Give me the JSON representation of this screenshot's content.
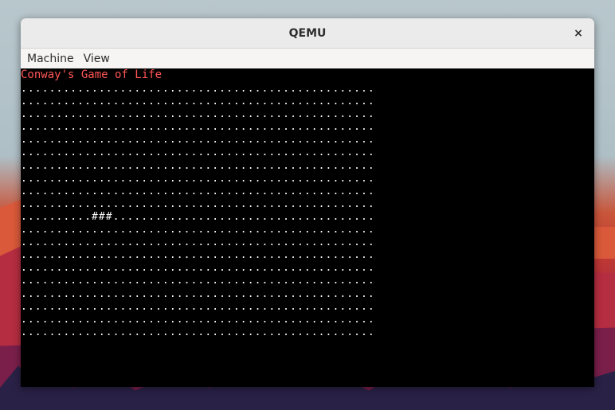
{
  "window": {
    "title": "QEMU",
    "close_icon": "×"
  },
  "menu": {
    "items": [
      "Machine",
      "View"
    ]
  },
  "screen": {
    "title": "Conway's Game of Life",
    "grid_rows": [
      "..................................................",
      "..................................................",
      "..................................................",
      "..................................................",
      "..................................................",
      "..................................................",
      "..................................................",
      "..................................................",
      "..................................................",
      "..................................................",
      "..........###.....................................",
      "..................................................",
      "..................................................",
      "..................................................",
      "..................................................",
      "..................................................",
      "..................................................",
      "..................................................",
      "..................................................",
      ".................................................."
    ]
  },
  "colors": {
    "title_text": "#ff5555",
    "grid_text": "#ffffff",
    "screen_bg": "#000000"
  }
}
